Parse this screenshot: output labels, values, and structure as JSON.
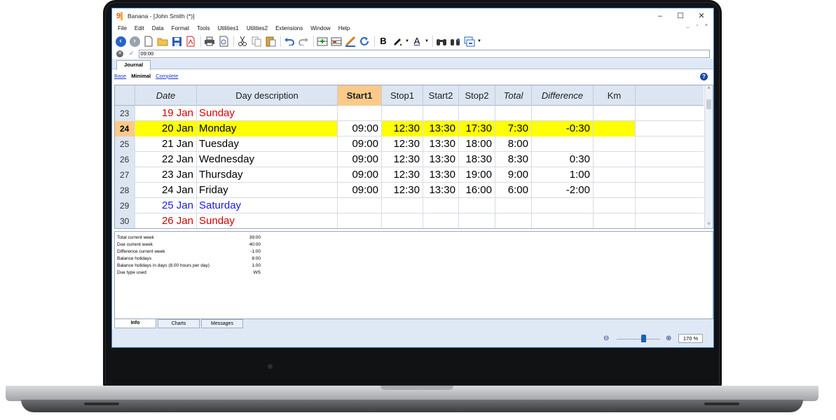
{
  "window": {
    "title": "Banana - [John Smith (*)]",
    "logo_text": "9",
    "minimize": "–",
    "maximize": "☐",
    "close": "✕",
    "mdi_controls": "_ ▫ ×"
  },
  "menu": [
    "File",
    "Edit",
    "Data",
    "Format",
    "Tools",
    "Utilities1",
    "Utilities2",
    "Extensions",
    "Window",
    "Help"
  ],
  "toolbar": {
    "back": "‹",
    "forward": "›",
    "bold_label": "B",
    "font_color_label": "A"
  },
  "formula_bar": {
    "cancel": "✕",
    "confirm": "✓",
    "value": "09:00"
  },
  "tabs": {
    "journal": "Journal"
  },
  "views": {
    "base": "Base",
    "minimal": "Minimal",
    "complete": "Complete"
  },
  "help": "?",
  "grid": {
    "columns": {
      "date": "Date",
      "description": "Day description",
      "start1": "Start1",
      "stop1": "Stop1",
      "start2": "Start2",
      "stop2": "Stop2",
      "total": "Total",
      "difference": "Difference",
      "km": "Km"
    },
    "rows": [
      {
        "num": "23",
        "date": "19 Jan",
        "desc": "Sunday",
        "start1": "",
        "stop1": "",
        "start2": "",
        "stop2": "",
        "total": "",
        "diff": "",
        "km": ""
      },
      {
        "num": "24",
        "date": "20 Jan",
        "desc": "Monday",
        "start1": "09:00",
        "stop1": "12:30",
        "start2": "13:30",
        "stop2": "17:30",
        "total": "7:30",
        "diff": "-0:30",
        "km": ""
      },
      {
        "num": "25",
        "date": "21 Jan",
        "desc": "Tuesday",
        "start1": "09:00",
        "stop1": "12:30",
        "start2": "13:30",
        "stop2": "18:00",
        "total": "8:00",
        "diff": "",
        "km": ""
      },
      {
        "num": "26",
        "date": "22 Jan",
        "desc": "Wednesday",
        "start1": "09:00",
        "stop1": "12:30",
        "start2": "13:30",
        "stop2": "18:30",
        "total": "8:30",
        "diff": "0:30",
        "km": ""
      },
      {
        "num": "27",
        "date": "23 Jan",
        "desc": "Thursday",
        "start1": "09:00",
        "stop1": "12:30",
        "start2": "13:30",
        "stop2": "19:00",
        "total": "9:00",
        "diff": "1:00",
        "km": ""
      },
      {
        "num": "28",
        "date": "24 Jan",
        "desc": "Friday",
        "start1": "09:00",
        "stop1": "12:30",
        "start2": "13:30",
        "stop2": "16:00",
        "total": "6:00",
        "diff": "-2:00",
        "km": ""
      },
      {
        "num": "29",
        "date": "25 Jan",
        "desc": "Saturday",
        "start1": "",
        "stop1": "",
        "start2": "",
        "stop2": "",
        "total": "",
        "diff": "",
        "km": ""
      },
      {
        "num": "30",
        "date": "26 Jan",
        "desc": "Sunday",
        "start1": "",
        "stop1": "",
        "start2": "",
        "stop2": "",
        "total": "",
        "diff": "",
        "km": ""
      }
    ],
    "scroll_up": "˄",
    "scroll_down": "˅"
  },
  "info": [
    {
      "label": "Total current week",
      "value": "39:00"
    },
    {
      "label": "Due current week",
      "value": "40:00"
    },
    {
      "label": "Difference current week",
      "value": "-1:00"
    },
    {
      "label": "Balance holidays",
      "value": "8:00"
    },
    {
      "label": "Balance holidays in days (8.00 hours per day)",
      "value": "1.00"
    },
    {
      "label": "Due type used",
      "value": "WS"
    }
  ],
  "bottom_tabs": {
    "info": "Info",
    "charts": "Charts",
    "messages": "Messages"
  },
  "zoom": {
    "level": "170 %",
    "zoom_out": "⊖",
    "zoom_in": "⊕"
  },
  "colors": {
    "weekend_sunday": "#d30000",
    "weekend_saturday": "#1919e6",
    "current_row": "#ffff00",
    "active_column": "#fbc98a",
    "header_bg": "#dce5f2"
  }
}
